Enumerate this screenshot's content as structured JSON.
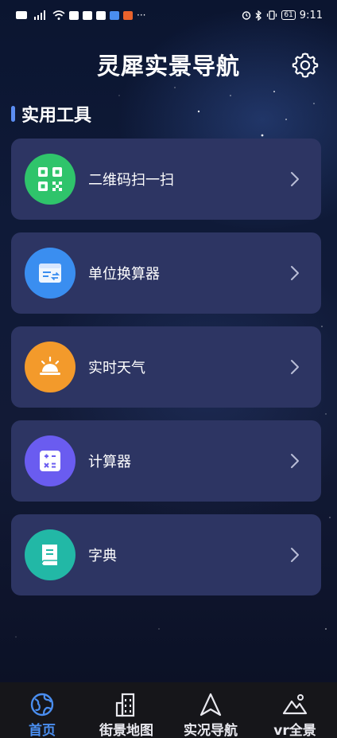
{
  "status_bar": {
    "left_icons": [
      "hd-icon",
      "signal-icon",
      "wifi-icon",
      "mail-icon",
      "mail-icon",
      "gift-icon",
      "shield-icon",
      "app-icon",
      "more-icon"
    ],
    "more_text": "···",
    "battery_level": "61",
    "time": "9:11"
  },
  "header": {
    "title": "灵犀实景导航",
    "settings_icon": "gear-icon"
  },
  "section": {
    "title": "实用工具",
    "accent_color": "#5b8df2"
  },
  "tools": [
    {
      "label": "二维码扫一扫",
      "icon": "qr-code-icon",
      "color": "#2fc46b"
    },
    {
      "label": "单位换算器",
      "icon": "converter-icon",
      "color": "#3a8ef0"
    },
    {
      "label": "实时天气",
      "icon": "weather-icon",
      "color": "#f39a2b"
    },
    {
      "label": "计算器",
      "icon": "calculator-icon",
      "color": "#6a5cf0"
    },
    {
      "label": "字典",
      "icon": "dictionary-icon",
      "color": "#22b8a6"
    }
  ],
  "nav": [
    {
      "label": "首页",
      "icon": "globe-icon",
      "active": true
    },
    {
      "label": "街景地图",
      "icon": "building-icon",
      "active": false
    },
    {
      "label": "实况导航",
      "icon": "navigation-arrow-icon",
      "active": false
    },
    {
      "label": "vr全景",
      "icon": "mountain-icon",
      "active": false
    }
  ],
  "colors": {
    "card_bg": "#2d3563",
    "nav_active": "#4a8ef0",
    "nav_bg": "#16161a"
  }
}
